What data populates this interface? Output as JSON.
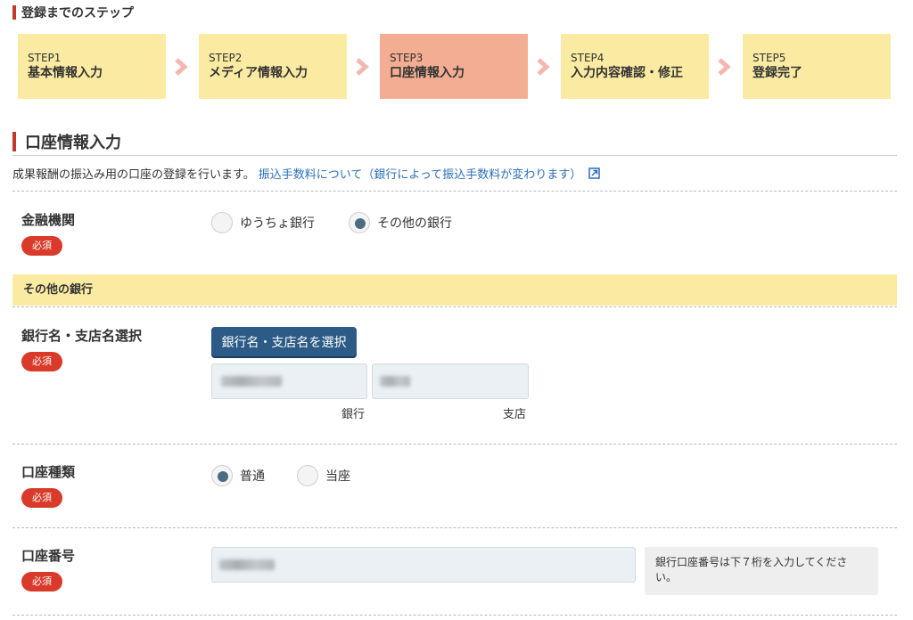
{
  "steps_heading": "登録までのステップ",
  "steps": [
    {
      "num": "STEP1",
      "name": "基本情報入力",
      "current": false
    },
    {
      "num": "STEP2",
      "name": "メディア情報入力",
      "current": false
    },
    {
      "num": "STEP3",
      "name": "口座情報入力",
      "current": true
    },
    {
      "num": "STEP4",
      "name": "入力内容確認・修正",
      "current": false
    },
    {
      "num": "STEP5",
      "name": "登録完了",
      "current": false
    }
  ],
  "section_title": "口座情報入力",
  "intro": {
    "text": "成果報酬の振込み用の口座の登録を行います。",
    "link": "振込手数料について（銀行によって振込手数料が変わります）"
  },
  "required_label": "必須",
  "financial_institution": {
    "label": "金融機関",
    "options": [
      {
        "label": "ゆうちょ銀行",
        "checked": false
      },
      {
        "label": "その他の銀行",
        "checked": true
      }
    ]
  },
  "other_bank_heading": "その他の銀行",
  "bank_select": {
    "label": "銀行名・支店名選択",
    "button": "銀行名・支店名を選択",
    "bank_caption": "銀行",
    "branch_caption": "支店"
  },
  "account_type": {
    "label": "口座種類",
    "options": [
      {
        "label": "普通",
        "checked": true
      },
      {
        "label": "当座",
        "checked": false
      }
    ]
  },
  "account_number": {
    "label": "口座番号",
    "note": "銀行口座番号は下７桁を入力してください。"
  },
  "colors": {
    "step_bg": "#fbeba2",
    "step_current_bg": "#f3ad92",
    "required_bg": "#d93a2a",
    "button_bg": "#2b5b86",
    "link": "#2a6fba",
    "accent_bar": "#c0392b"
  }
}
